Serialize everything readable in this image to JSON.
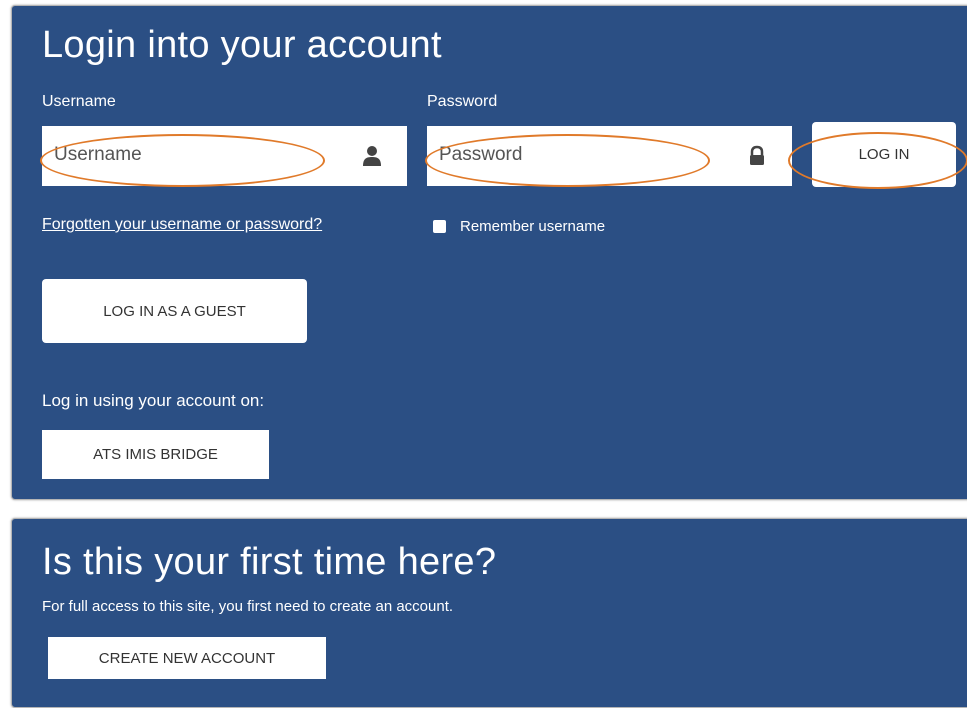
{
  "login": {
    "title": "Login into your account",
    "username_label": "Username",
    "username_placeholder": "Username",
    "password_label": "Password",
    "password_placeholder": "Password",
    "login_button": "LOG IN",
    "forgot_link": "Forgotten your username or password?",
    "remember_label": "Remember username",
    "guest_button": "LOG IN AS A GUEST",
    "external_heading": "Log in using your account on:",
    "external_button": "ATS IMIS BRIDGE"
  },
  "first_time": {
    "title": "Is this your first time here?",
    "description": "For full access to this site, you first need to create an account.",
    "create_button": "CREATE NEW ACCOUNT"
  },
  "colors": {
    "panel_bg": "#2b4f84",
    "annotation": "#e07a2a"
  },
  "icons": {
    "username": "user-icon",
    "password": "lock-icon"
  }
}
